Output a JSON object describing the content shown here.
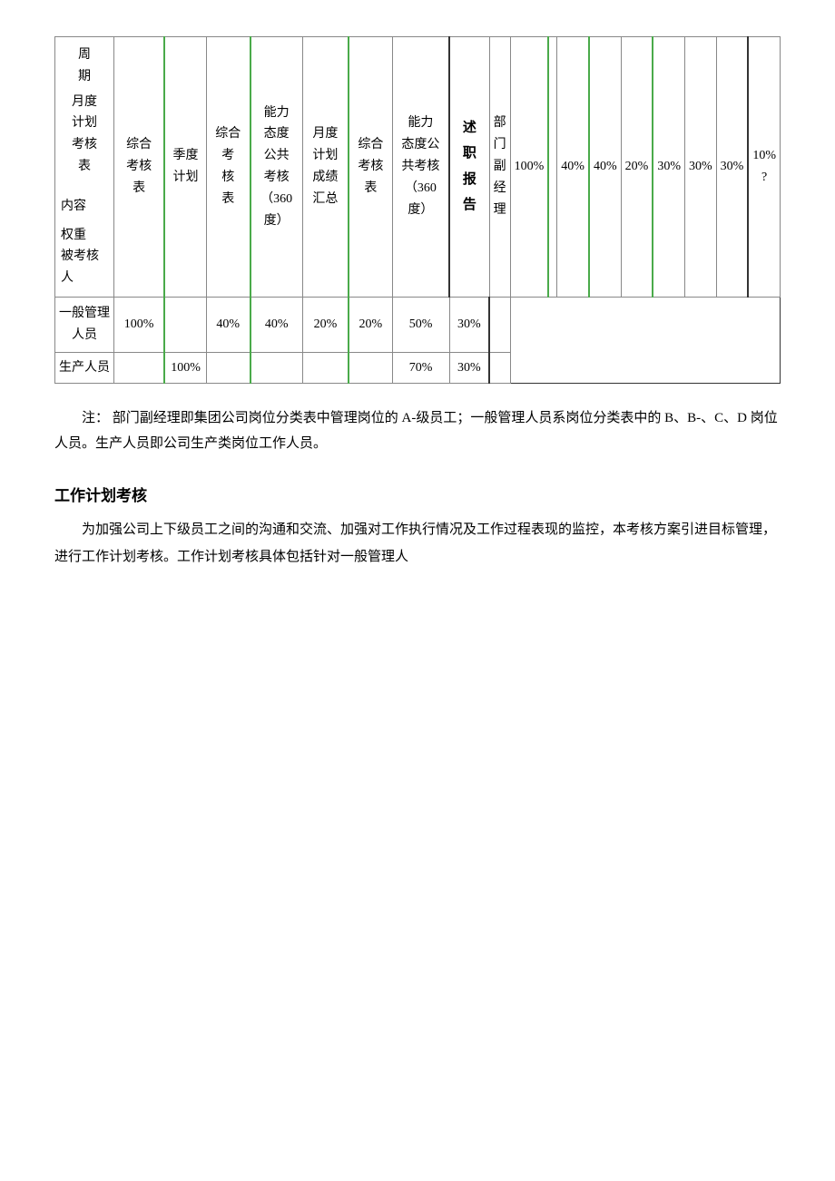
{
  "table": {
    "headers": {
      "row1": {
        "neirong": "内容\n\n权重\n被考核人",
        "col1": "周\n期\n月度\n计划\n考核\n表",
        "col2": "综合\n考核\n表",
        "col3": "季度\n计划",
        "col4": "综合\n考\n核\n表",
        "col5": "能力\n态度\n公共\n考核\n（360\n度）",
        "col6": "月度\n计划\n成绩\n汇总",
        "col7": "综合\n考核\n表",
        "col8": "能力\n态度公\n共考核\n（360\n度）",
        "col9": "述\n职\n报\n告"
      }
    },
    "rows": [
      {
        "name": "部门副经\n理",
        "col1": "100%",
        "col2": "",
        "col3": "40%",
        "col4": "40%",
        "col5": "20%",
        "col6": "30%",
        "col7": "30%",
        "col8": "30%",
        "col9": "10%\n?"
      },
      {
        "name": "一般管理\n人员",
        "col1": "100%",
        "col2": "",
        "col3": "40%",
        "col4": "40%",
        "col5": "20%",
        "col6": "20%",
        "col7": "50%",
        "col8": "30%",
        "col9": ""
      },
      {
        "name": "生产人员",
        "col1": "",
        "col2": "100%",
        "col3": "",
        "col4": "",
        "col5": "",
        "col6": "",
        "col7": "70%",
        "col8": "30%",
        "col9": ""
      }
    ]
  },
  "note": {
    "label": "注：",
    "text": "部门副经理即集团公司岗位分类表中管理岗位的 A-级员工；一般管理人员系岗位分类表中的 B、B-、C、D 岗位人员。生产人员即公司生产类岗位工作人员。"
  },
  "section": {
    "title": "工作计划考核",
    "body": "为加强公司上下级员工之间的沟通和交流、加强对工作执行情况及工作过程表现的监控，本考核方案引进目标管理，进行工作计划考核。工作计划考核具体包括针对一般管理人"
  }
}
